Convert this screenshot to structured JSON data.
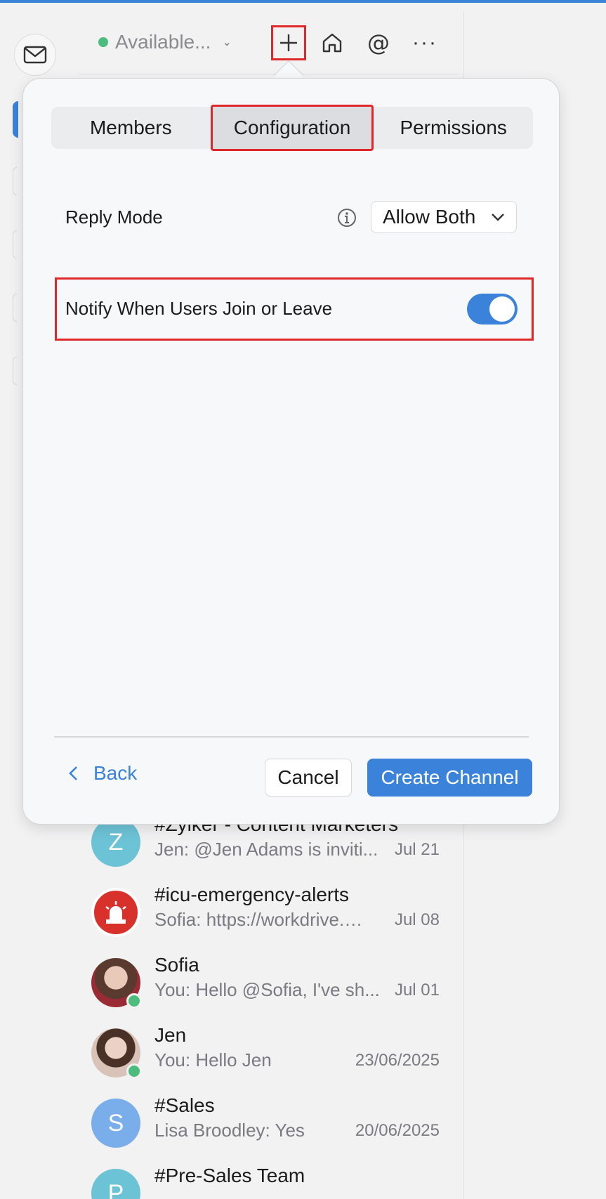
{
  "topbar": {
    "status_label": "Available...",
    "icons": [
      "plus-icon",
      "home-icon",
      "mention-icon",
      "more-icon"
    ],
    "at_symbol": "@"
  },
  "dialog": {
    "tabs": [
      "Members",
      "Configuration",
      "Permissions"
    ],
    "active_tab": "Configuration",
    "reply_mode_label": "Reply Mode",
    "reply_mode_value": "Allow Both",
    "notify_label": "Notify When Users Join or Leave",
    "notify_enabled": true,
    "back_label": "Back",
    "cancel_label": "Cancel",
    "create_label": "Create Channel"
  },
  "chats": [
    {
      "title": "#Zylker - Content Marketers",
      "preview": "Jen: @Jen Adams  is inviti...",
      "date": "Jul 21",
      "avatar_letter": "Z",
      "avatar_color": "#6cc3d5"
    },
    {
      "title": "#icu-emergency-alerts",
      "preview": "Sofia: https://workdrive.…",
      "date": "Jul 08",
      "avatar_letter": "",
      "avatar_color": "#d8312b",
      "avatar_badge": "EMERGENCY"
    },
    {
      "title": "Sofia",
      "preview": "You: Hello @Sofia, I've sh...",
      "date": "Jul 01",
      "avatar_letter": "",
      "avatar_color": "#b88a7a",
      "online": true
    },
    {
      "title": "Jen",
      "preview": "You: Hello Jen",
      "date": "23/06/2025",
      "avatar_letter": "",
      "avatar_color": "#c9a99b",
      "online": true
    },
    {
      "title": "#Sales",
      "preview": "Lisa Broodley: Yes",
      "date": "20/06/2025",
      "avatar_letter": "S",
      "avatar_color": "#7aaeea"
    },
    {
      "title": "#Pre-Sales Team",
      "preview": "",
      "date": "",
      "avatar_letter": "P",
      "avatar_color": "#6cc3d5"
    }
  ],
  "colors": {
    "accent": "#3b82db",
    "highlight_box": "#e0282b",
    "online": "#4cbc7c"
  }
}
